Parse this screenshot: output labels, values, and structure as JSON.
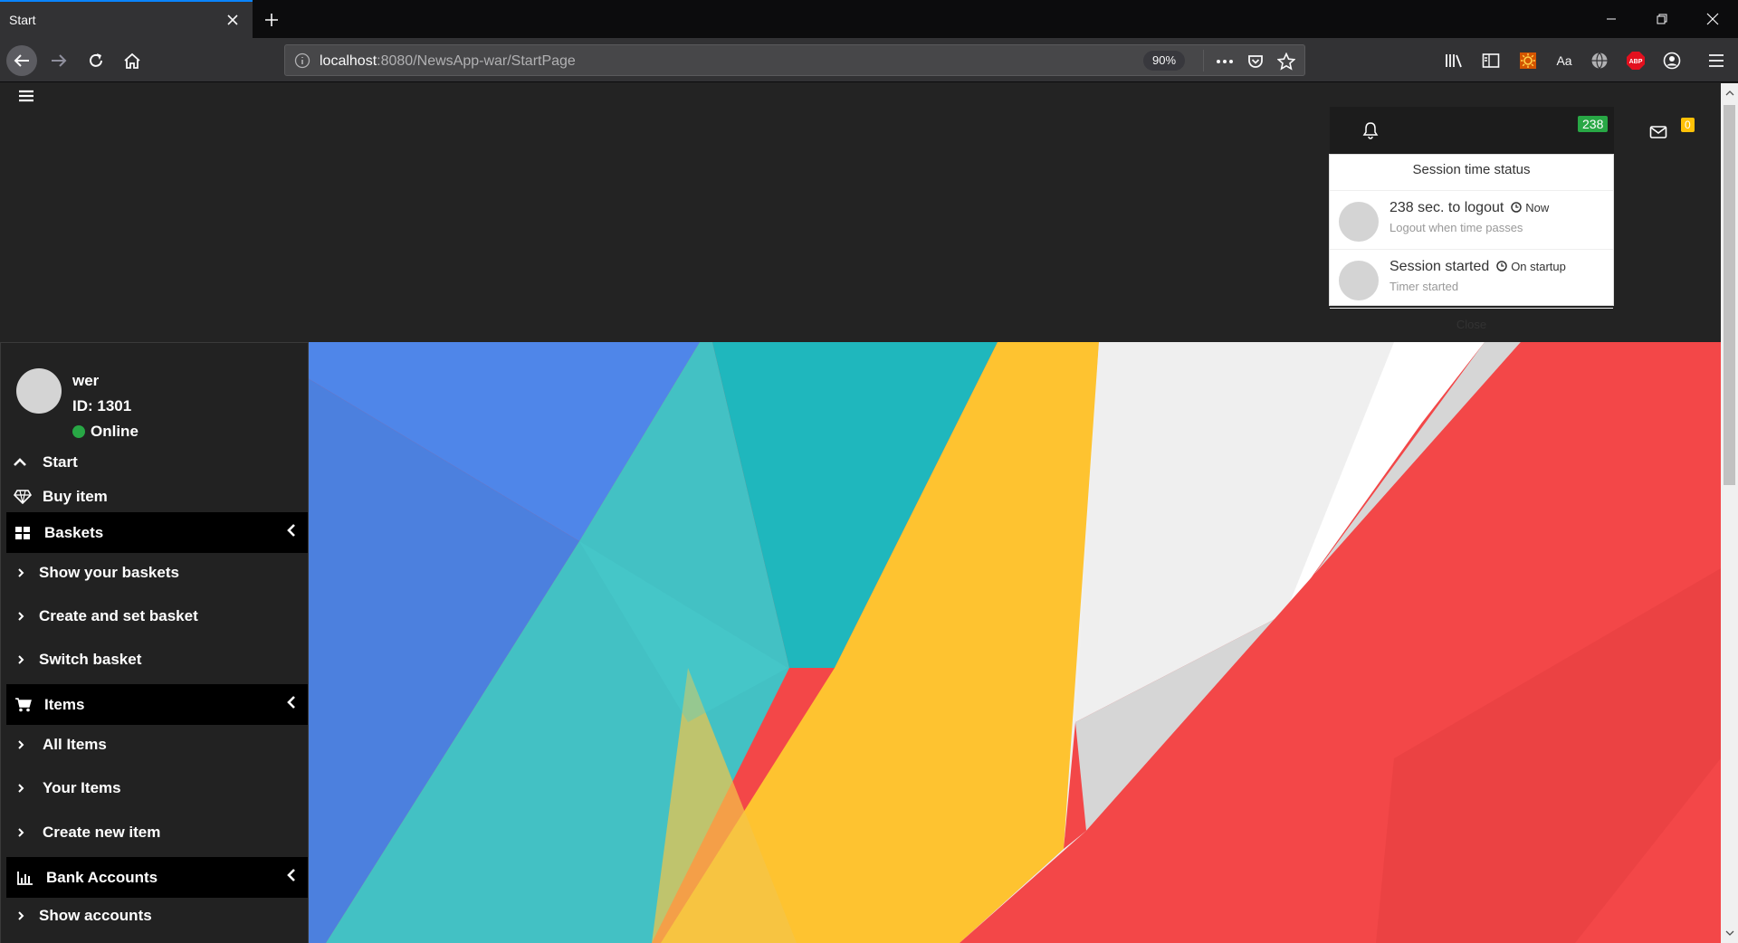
{
  "browser": {
    "tab_title": "Start",
    "url_host": "localhost",
    "url_rest": ":8080/NewsApp-war/StartPage",
    "zoom": "90%",
    "reader_label": "Aa",
    "adblock_label": "ABP"
  },
  "header": {
    "notification_count": "238",
    "mail_count": "0"
  },
  "session_dropdown": {
    "title": "Session time status",
    "items": [
      {
        "title": "238 sec. to logout",
        "time": "Now",
        "subtitle": "Logout when time passes"
      },
      {
        "title": "Session started",
        "time": "On startup",
        "subtitle": "Timer started"
      }
    ],
    "close_label": "Close"
  },
  "sidebar": {
    "user_name": "wer",
    "user_id": "ID: 1301",
    "status": "Online",
    "start_label": "Start",
    "buy_label": "Buy item",
    "baskets": {
      "label": "Baskets",
      "items": [
        "Show your baskets",
        "Create and set basket",
        "Switch basket"
      ]
    },
    "items_section": {
      "label": "Items",
      "items": [
        "All Items",
        "Your Items",
        "Create new item"
      ]
    },
    "bank": {
      "label": "Bank Accounts",
      "items": [
        "Show accounts"
      ]
    }
  },
  "colors": {
    "blue": "#4f86e9",
    "teal": "#43c1c4",
    "yellow": "#fec330",
    "red": "#f34748",
    "online": "#28a745"
  }
}
